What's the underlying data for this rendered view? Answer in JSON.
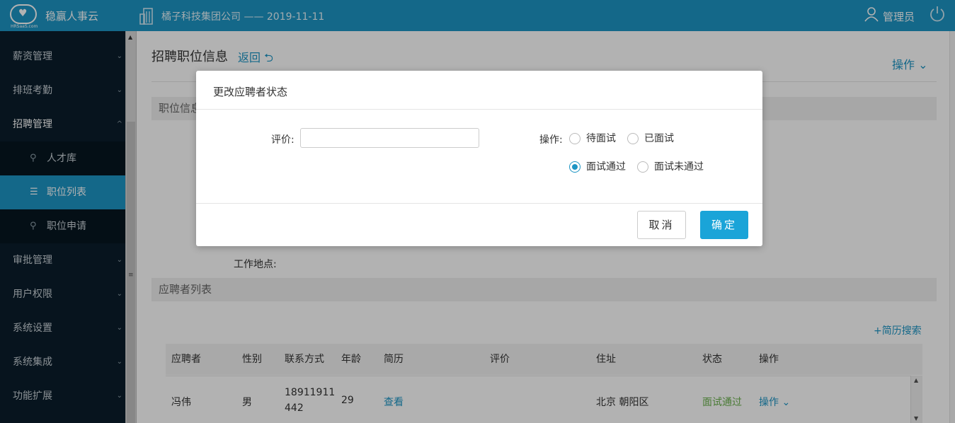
{
  "header": {
    "logo_sub": "HRSaaS.com",
    "brand": "稳赢人事云",
    "company": "橘子科技集团公司 —— 2019-11-11",
    "user": "管理员"
  },
  "sidebar": {
    "items": [
      {
        "label": "薪资管理",
        "chev": "⌄"
      },
      {
        "label": "排班考勤",
        "chev": "⌄"
      },
      {
        "label": "招聘管理",
        "chev": "^"
      },
      {
        "label": "审批管理",
        "chev": "⌄"
      },
      {
        "label": "用户权限",
        "chev": "⌄"
      },
      {
        "label": "系统设置",
        "chev": "⌄"
      },
      {
        "label": "系统集成",
        "chev": "⌄"
      },
      {
        "label": "功能扩展",
        "chev": "⌄"
      }
    ],
    "subitems": [
      {
        "label": "人才库",
        "icon": "people-icon"
      },
      {
        "label": "职位列表",
        "icon": "list-icon"
      },
      {
        "label": "职位申请",
        "icon": "people-icon"
      }
    ]
  },
  "main": {
    "page_title": "招聘职位信息",
    "back_label": "返回 ⮌",
    "ops_label": "操作 ⌄",
    "section_position": "职位信息",
    "work_location_label": "工作地点:",
    "section_applicants": "应聘者列表",
    "resume_search": "+简历搜索",
    "table": {
      "headers": [
        "应聘者",
        "性别",
        "联系方式",
        "年龄",
        "简历",
        "评价",
        "住址",
        "状态",
        "操作"
      ],
      "rows": [
        {
          "name": "冯伟",
          "gender": "男",
          "phone_1": "18911911",
          "phone_2": "442",
          "age": "29",
          "resume": "查看",
          "evaluation": "",
          "address": "北京 朝阳区",
          "status": "面试通过",
          "action": "操作 ⌄"
        }
      ]
    }
  },
  "modal": {
    "title": "更改应聘者状态",
    "eval_label": "评价:",
    "eval_value": "",
    "op_label": "操作:",
    "options": [
      {
        "label": "待面试",
        "checked": false
      },
      {
        "label": "已面试",
        "checked": false
      },
      {
        "label": "面试通过",
        "checked": true
      },
      {
        "label": "面试未通过",
        "checked": false
      }
    ],
    "cancel": "取消",
    "ok": "确定"
  },
  "colors": {
    "accent": "#1d95c4",
    "sidebar_bg": "#0b1e2b",
    "status_green": "#6ab04c",
    "ok_button": "#1aa4d8"
  }
}
